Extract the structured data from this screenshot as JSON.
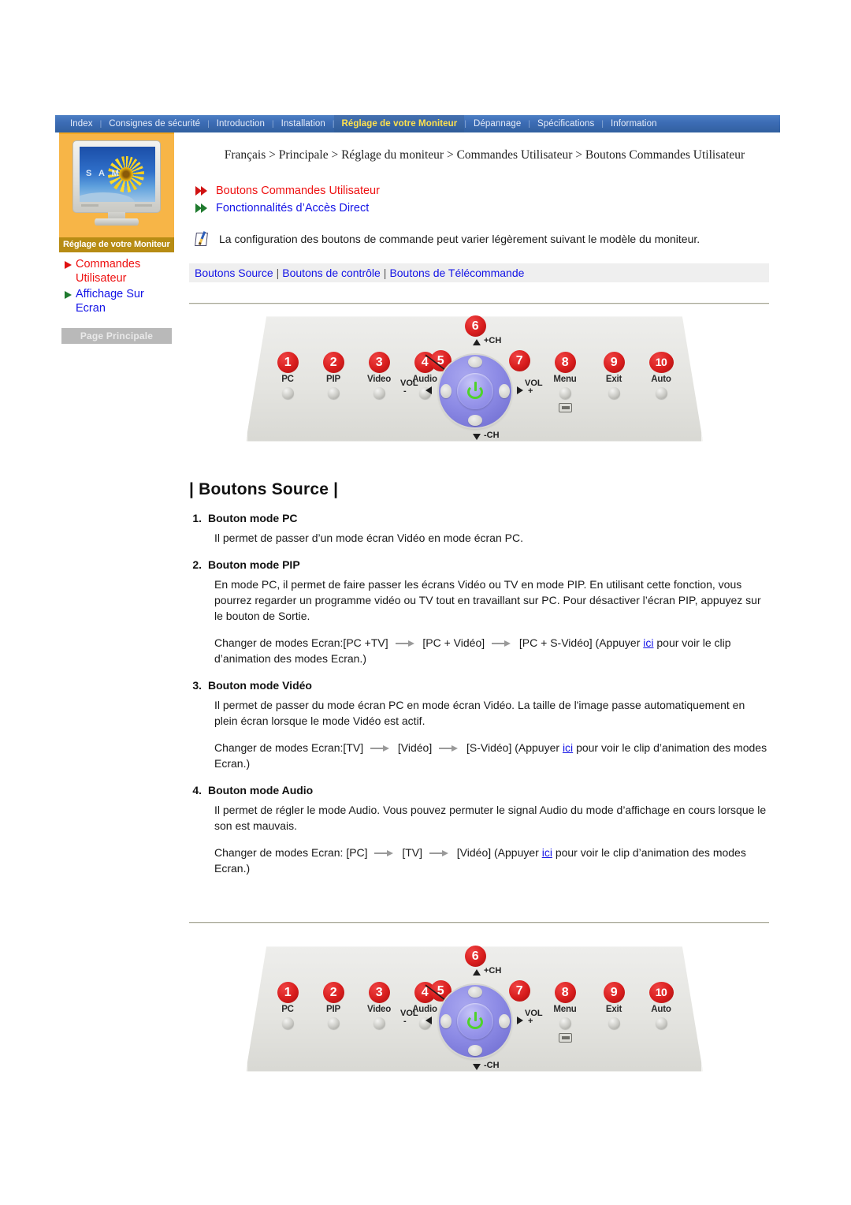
{
  "nav": {
    "items": [
      {
        "label": "Index",
        "active": false
      },
      {
        "label": "Consignes de sécurité",
        "active": false
      },
      {
        "label": "Introduction",
        "active": false
      },
      {
        "label": "Installation",
        "active": false
      },
      {
        "label": "Réglage de votre Moniteur",
        "active": true
      },
      {
        "label": "Dépannage",
        "active": false
      },
      {
        "label": "Spécifications",
        "active": false
      },
      {
        "label": "Information",
        "active": false
      }
    ],
    "separator": "|"
  },
  "sidebar": {
    "caption": "Réglage de votre Moniteur",
    "monitor_screen_text": "S A M",
    "links": [
      {
        "label": "Commandes Utilisateur",
        "color": "#ee1111",
        "arrow_color": "#e01010"
      },
      {
        "label": "Affichage Sur Ecran",
        "color": "#1414e6",
        "arrow_color": "#1f7a2e"
      }
    ],
    "home_button": "Page Principale"
  },
  "breadcrumb": "Français > Principale > Réglage du moniteur > Commandes Utilisateur > Boutons Commandes Utilisateur",
  "head_links": [
    {
      "label": "Boutons Commandes Utilisateur",
      "color": "red"
    },
    {
      "label": "Fonctionnalités d’Accès Direct",
      "color": "blue"
    }
  ],
  "notice": "La configuration des boutons de commande peut varier légèrement suivant le modèle du moniteur.",
  "subtabs": {
    "items": [
      "Boutons Source",
      "Boutons de contrôle",
      "Boutons de Télécommande"
    ],
    "separator": "|"
  },
  "control_panel": {
    "buttons": [
      {
        "num": "1",
        "label": "PC"
      },
      {
        "num": "2",
        "label": "PIP"
      },
      {
        "num": "3",
        "label": "Video"
      },
      {
        "num": "4",
        "label": "Audio"
      },
      {
        "num": "5",
        "label": ""
      },
      {
        "num": "6",
        "label": ""
      },
      {
        "num": "7",
        "label": ""
      },
      {
        "num": "8",
        "label": "Menu"
      },
      {
        "num": "9",
        "label": "Exit"
      },
      {
        "num": "10",
        "label": "Auto"
      }
    ],
    "jog_labels": {
      "ch_up": "+CH",
      "ch_down": "-CH",
      "vol_minus": "VOL\n-",
      "vol_plus": "VOL\n+",
      "vol_minus_line1": "VOL",
      "vol_minus_line2": "-",
      "vol_plus_line1": "VOL",
      "vol_plus_line2": "+"
    }
  },
  "section": {
    "title": "| Boutons Source |"
  },
  "items": [
    {
      "num": "1.",
      "heading": "Bouton mode PC",
      "body": "Il permet de passer d’un mode écran Vidéo en mode écran PC.",
      "flow": null
    },
    {
      "num": "2.",
      "heading": "Bouton mode PIP",
      "body": "En mode PC, il permet de faire passer les écrans Vidéo ou TV en mode PIP. En utilisant cette fonction, vous pourrez regarder un programme vidéo ou TV tout en travaillant sur PC. Pour désactiver l’écran PIP, appuyez sur le bouton de Sortie.",
      "flow": {
        "prefix": "Changer de modes Ecran:[PC +TV]",
        "step1": "[PC + Vidéo]",
        "step2": "[PC + S-Vidéo] (Appuyer",
        "link": "ici",
        "suffix": "pour voir le clip d’animation des modes Ecran.)"
      }
    },
    {
      "num": "3.",
      "heading": "Bouton mode Vidéo",
      "body": "Il permet de passer du mode écran PC en mode écran Vidéo. La taille de l'image passe automatiquement en plein écran lorsque le mode Vidéo est actif.",
      "flow": {
        "prefix": "Changer de modes Ecran:[TV]",
        "step1": "[Vidéo]",
        "step2": "[S-Vidéo] (Appuyer",
        "link": "ici",
        "suffix": "pour voir le clip d’animation des modes Ecran.)"
      }
    },
    {
      "num": "4.",
      "heading": "Bouton mode Audio",
      "body": "Il permet de régler le mode Audio. Vous pouvez permuter le signal Audio du mode d’affichage en cours lorsque le son est mauvais.",
      "flow": {
        "prefix": "Changer de modes Ecran: [PC]",
        "step1": "[TV]",
        "step2": "[Vidéo] (Appuyer",
        "link": "ici",
        "suffix": "pour voir le clip d’animation des modes Ecran.)"
      }
    }
  ],
  "colors": {
    "nav_active_text": "#ffe14d",
    "nav_bg": "#3d6db6",
    "sidebar_orange": "#f7b547",
    "sidebar_caption_bg": "#b78c14",
    "link_blue": "#1414e6",
    "link_red": "#ee1111",
    "badge_red": "#d81d1d",
    "jog_purple": "#8e8ce6",
    "power_green": "#4ed32a"
  }
}
